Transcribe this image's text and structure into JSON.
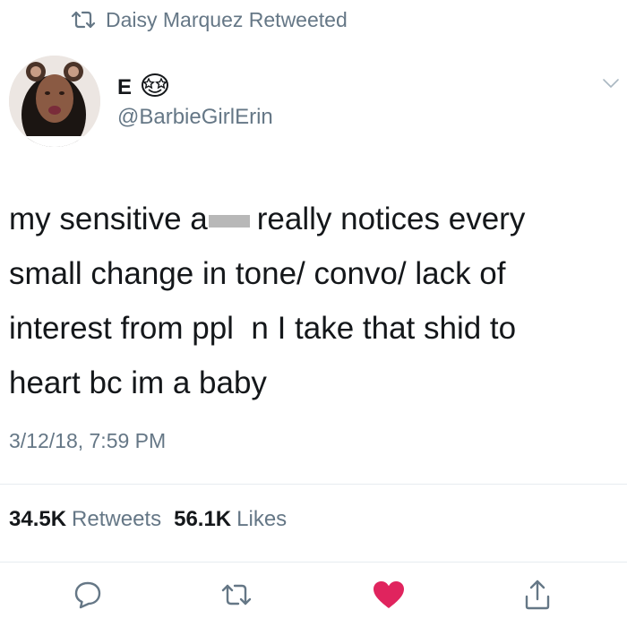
{
  "retweet_header": {
    "icon": "retweet-icon",
    "text": "Daisy Marquez Retweeted"
  },
  "author": {
    "display_name": "E",
    "name_emoji": "star-struck-emoji",
    "handle": "@BarbieGirlErin"
  },
  "tweet": {
    "text_before_redaction": "my sensitive a",
    "text_after_redaction": "really notices every\nsmall change in tone/ convo/ lack of\ninterest from ppl  n I take that shid to\nheart bc im a baby",
    "timestamp": "3/12/18, 7:59 PM"
  },
  "stats": {
    "retweets_count": "34.5K",
    "retweets_label": "Retweets",
    "likes_count": "56.1K",
    "likes_label": "Likes"
  },
  "actions": [
    {
      "icon": "reply-icon"
    },
    {
      "icon": "retweet-icon"
    },
    {
      "icon": "like-heart-icon",
      "active": true
    },
    {
      "icon": "share-icon"
    }
  ],
  "colors": {
    "secondary_text": "#657786",
    "primary_text": "#14171a",
    "like_active": "#e0245e",
    "divider": "#e6ecf0"
  }
}
